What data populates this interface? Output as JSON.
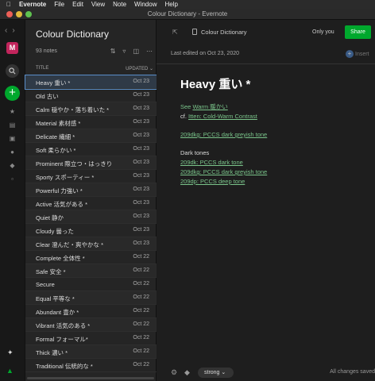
{
  "menubar": {
    "apple": "",
    "app": "Evernote",
    "items": [
      "File",
      "Edit",
      "View",
      "Note",
      "Window",
      "Help"
    ]
  },
  "window": {
    "title": "Colour Dictionary - Evernote"
  },
  "rail": {
    "avatar": "M",
    "search_icon": "search-icon",
    "new_icon": "+"
  },
  "list": {
    "title": "Colour Dictionary",
    "count": "93 notes",
    "columns": {
      "title": "TITLE",
      "updated": "UPDATED ⌄"
    },
    "notes": [
      {
        "title": "Heavy 重い *",
        "date": "Oct 23"
      },
      {
        "title": "Old 古い",
        "date": "Oct 23"
      },
      {
        "title": "Calm 穏やか・落ち着いた *",
        "date": "Oct 23"
      },
      {
        "title": "Material 素材感 *",
        "date": "Oct 23"
      },
      {
        "title": "Delicate 繊細 *",
        "date": "Oct 23"
      },
      {
        "title": "Soft 柔らかい *",
        "date": "Oct 23"
      },
      {
        "title": "Prominent 際立つ・はっきり",
        "date": "Oct 23"
      },
      {
        "title": "Sporty スポーティー *",
        "date": "Oct 23"
      },
      {
        "title": "Powerful 力強い *",
        "date": "Oct 23"
      },
      {
        "title": "Active 活気がある *",
        "date": "Oct 23"
      },
      {
        "title": "Quiet 静か",
        "date": "Oct 23"
      },
      {
        "title": "Cloudy 曇った",
        "date": "Oct 23"
      },
      {
        "title": "Clear 澄んだ・爽やかな *",
        "date": "Oct 23"
      },
      {
        "title": "Complete 全体性 *",
        "date": "Oct 22"
      },
      {
        "title": "Safe 安全 *",
        "date": "Oct 22"
      },
      {
        "title": "Secure",
        "date": "Oct 22"
      },
      {
        "title": "Equal 平等な *",
        "date": "Oct 22"
      },
      {
        "title": "Abundant 豊か *",
        "date": "Oct 22"
      },
      {
        "title": "Vibrant 活気のある *",
        "date": "Oct 22"
      },
      {
        "title": "Formal フォーマル*",
        "date": "Oct 22"
      },
      {
        "title": "Thick 濃い *",
        "date": "Oct 22"
      },
      {
        "title": "Traditional 伝統的な *",
        "date": "Oct 22"
      }
    ]
  },
  "editor": {
    "notebook": "Colour Dictionary",
    "only_you": "Only you",
    "share": "Share",
    "last_edited": "Last edited on Oct 23, 2020",
    "insert": "Insert",
    "note_title": "Heavy 重い *",
    "lines": {
      "see_prefix": "See ",
      "see_link": "Warm 暖かい",
      "cf_prefix": "cf. ",
      "cf_link": "Itten: Cold-Warm Contrast",
      "link_209dkg_1": "209dkg: PCCS dark greyish tone",
      "dark_tones": "Dark tones",
      "link_209dk": "209dk: PCCS dark tone",
      "link_209dkg_2": "209dkg: PCCS dark greyish tone",
      "link_209dp": "209dp: PCCS deep tone"
    },
    "tag": "strong",
    "saved": "All changes saved"
  },
  "colors": {
    "accent_green": "#00a82d",
    "link_green": "#7ac48a",
    "selected_row": "#2f3a47"
  }
}
